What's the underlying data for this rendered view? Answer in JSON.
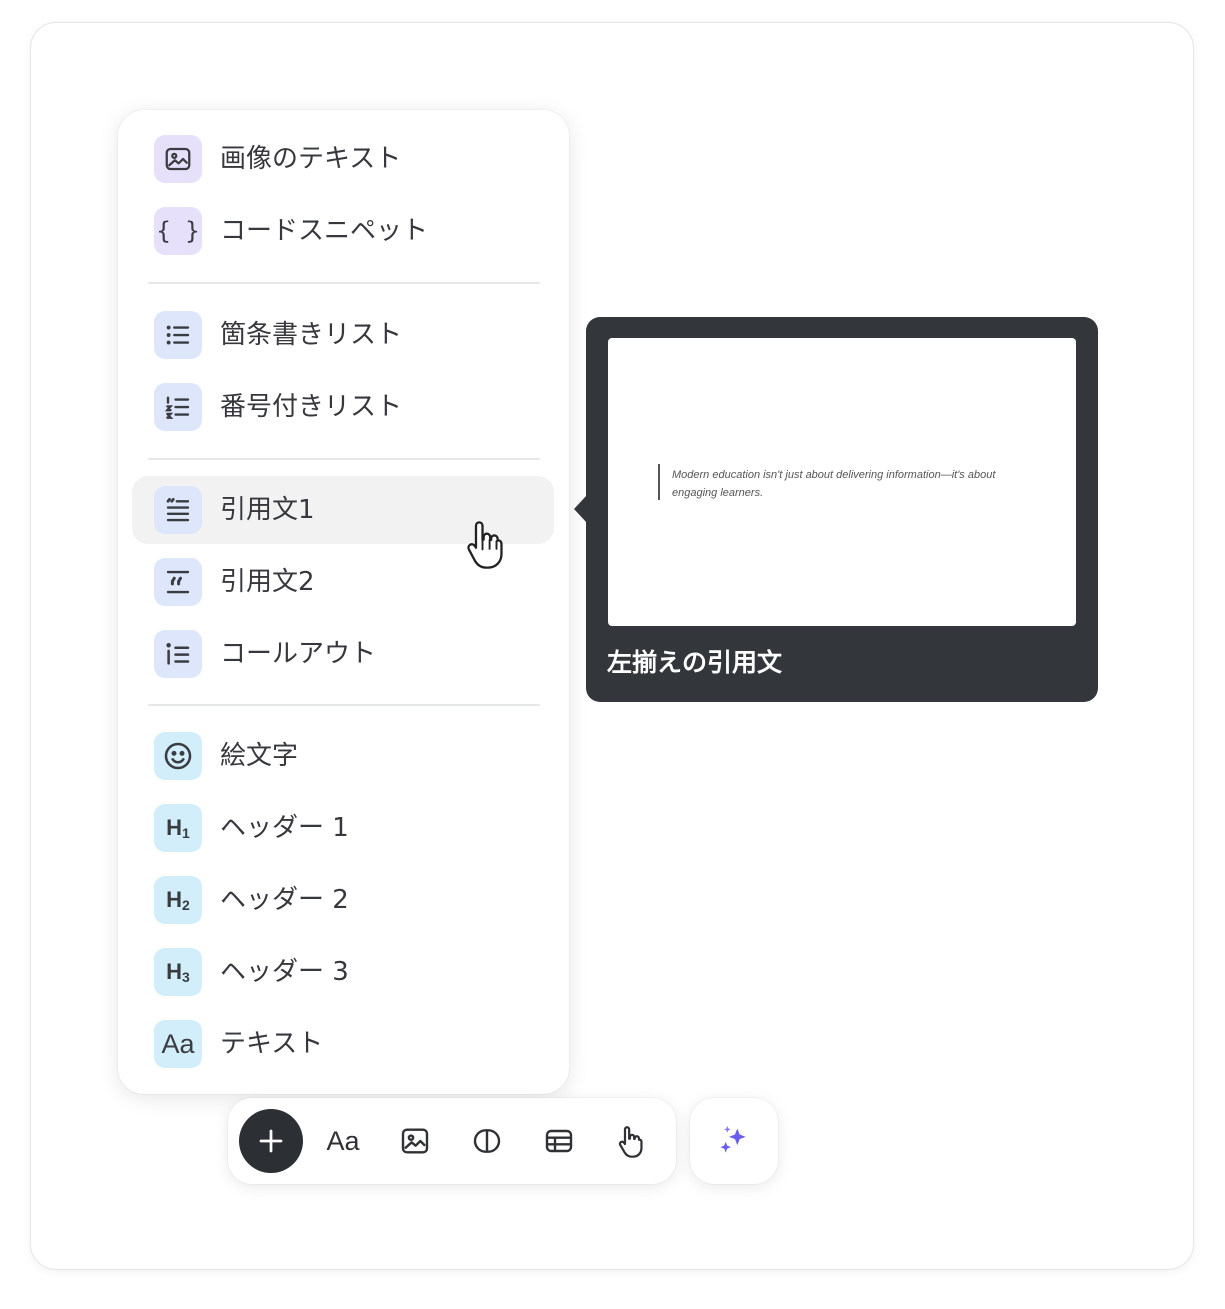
{
  "menu": {
    "items": [
      {
        "label": "画像のテキスト",
        "icon": "image-text-icon"
      },
      {
        "label": "コードスニペット",
        "icon": "code-braces-icon",
        "icon_text": "{ }"
      },
      {
        "label": "箇条書きリスト",
        "icon": "bullet-list-icon"
      },
      {
        "label": "番号付きリスト",
        "icon": "numbered-list-icon"
      },
      {
        "label": "引用文1",
        "icon": "quote-1-icon"
      },
      {
        "label": "引用文2",
        "icon": "quote-2-icon"
      },
      {
        "label": "コールアウト",
        "icon": "callout-icon"
      },
      {
        "label": "絵文字",
        "icon": "emoji-icon"
      },
      {
        "label": "ヘッダー 1",
        "icon": "header-1-icon"
      },
      {
        "label": "ヘッダー 2",
        "icon": "header-2-icon"
      },
      {
        "label": "ヘッダー 3",
        "icon": "header-3-icon"
      },
      {
        "label": "テキスト",
        "icon": "text-icon",
        "icon_text": "Aa"
      }
    ],
    "hovered_item": "引用文1"
  },
  "preview": {
    "quote_text": "Modern education isn't just about delivering information—it's about engaging learners.",
    "caption": "左揃えの引用文"
  },
  "toolbar": {
    "text_label": "Aa",
    "buttons": [
      "plus-icon",
      "text-style-icon",
      "image-icon",
      "column-layout-icon",
      "table-icon",
      "hand-pointer-icon"
    ],
    "ai_button": "sparkles-icon"
  },
  "colors": {
    "purple_chip": "#e7e0fb",
    "blue_chip": "#dde6fb",
    "cyan_chip": "#d2eefa",
    "tooltip_bg": "#33363a",
    "hover_bg": "#f2f2f3",
    "sparkle_accent": "#6a5cf0"
  }
}
